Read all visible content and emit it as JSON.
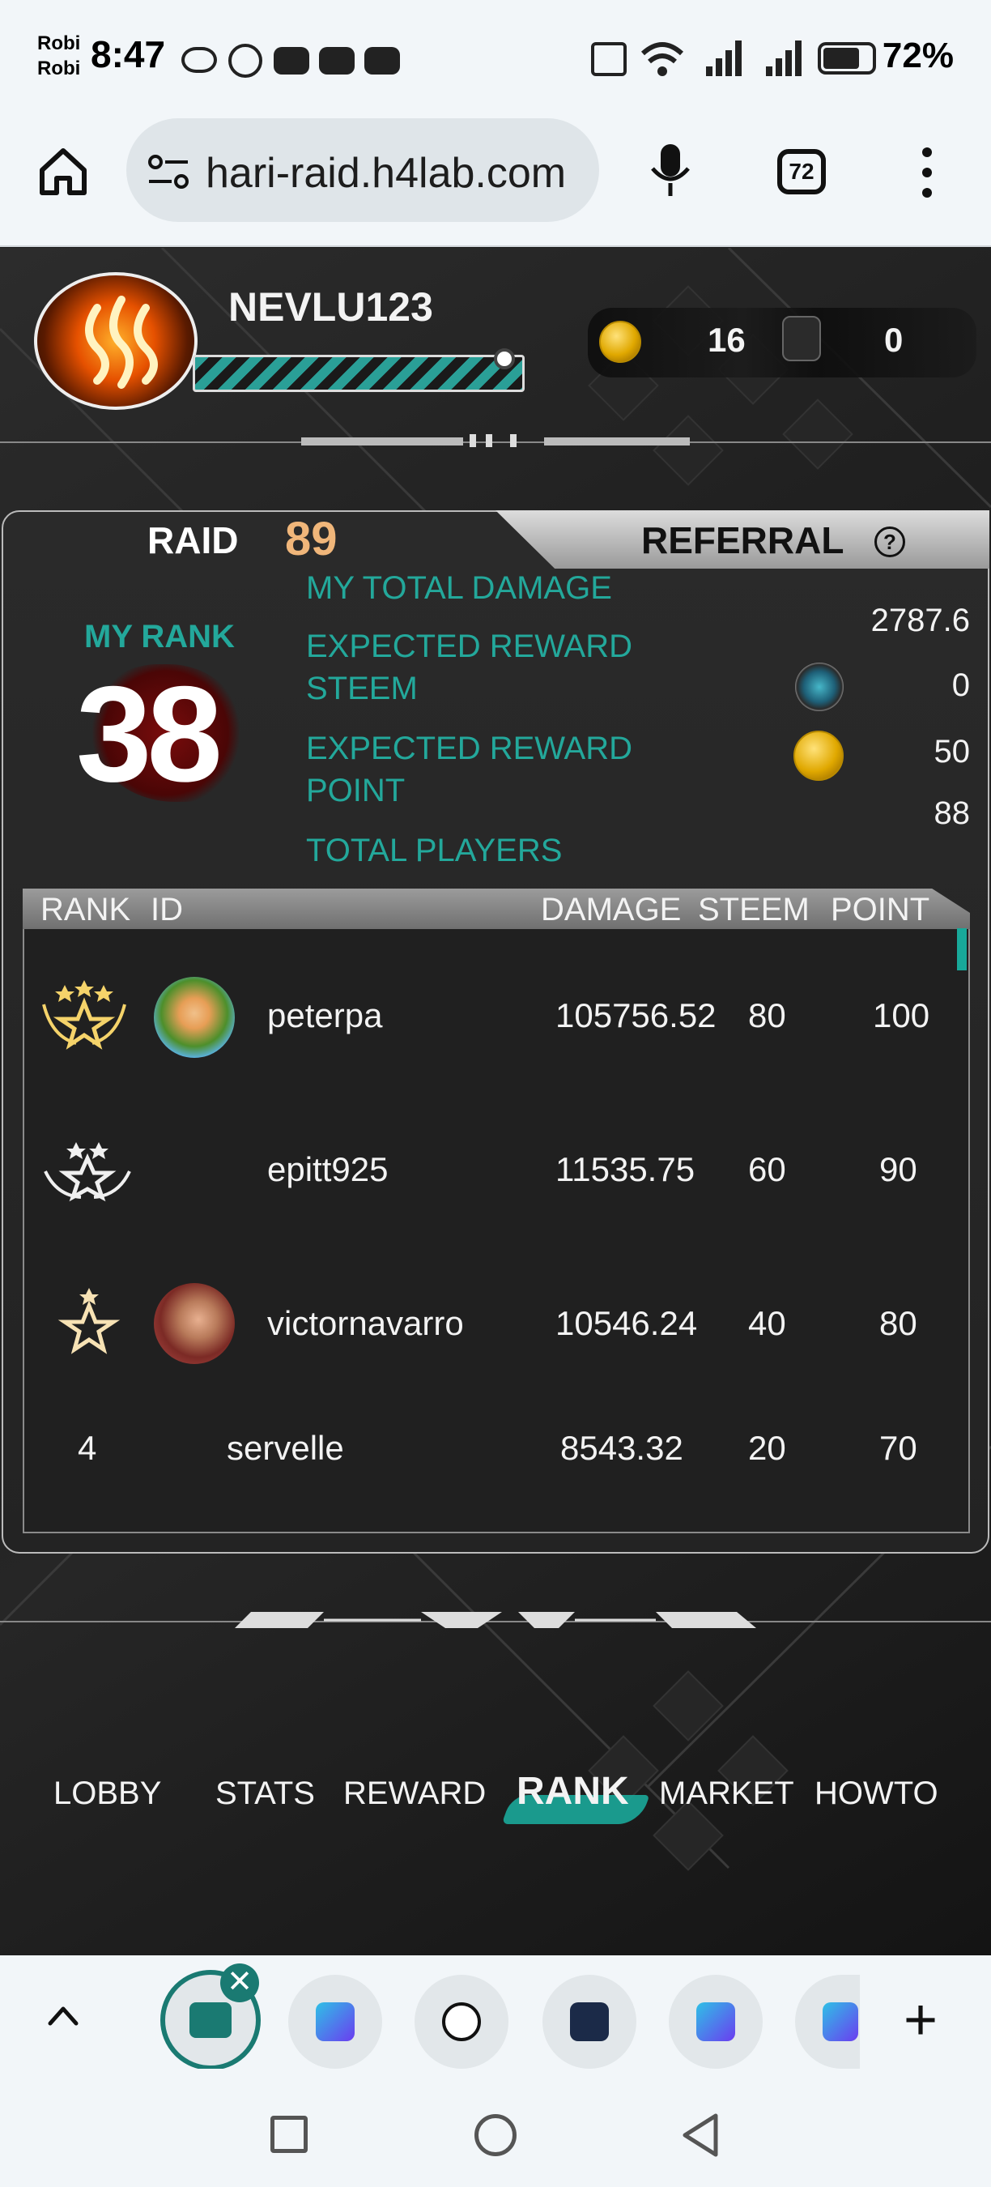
{
  "status_bar": {
    "carrier_line1": "Robi",
    "carrier_line2": "Robi",
    "time": "8:47",
    "battery": "72%"
  },
  "browser": {
    "url": "hari-raid.h4lab.com",
    "tab_count": "72"
  },
  "header": {
    "username": "NEVLU123",
    "points": "16",
    "tickets": "0"
  },
  "panel": {
    "raid_label": "RAID",
    "raid_number": "89",
    "referral_label": "REFERRAL",
    "help_glyph": "?",
    "my_rank_label": "MY RANK",
    "my_rank_value": "38",
    "stats": {
      "total_damage_label": "MY TOTAL DAMAGE",
      "total_damage_value": "2787.6",
      "reward_steem_label_1": "EXPECTED REWARD",
      "reward_steem_label_2": "STEEM",
      "reward_steem_value": "0",
      "reward_point_label_1": "EXPECTED REWARD",
      "reward_point_label_2": "POINT",
      "reward_point_value": "50",
      "total_players_label": "TOTAL PLAYERS",
      "total_players_value": "88"
    }
  },
  "table": {
    "headers": {
      "rank": "RANK",
      "id": "ID",
      "damage": "DAMAGE",
      "steem": "STEEM",
      "point": "POINT"
    },
    "rows": [
      {
        "rank": "1",
        "id": "peterpa",
        "damage": "105756.52",
        "steem": "80",
        "point": "100"
      },
      {
        "rank": "2",
        "id": "epitt925",
        "damage": "11535.75",
        "steem": "60",
        "point": "90"
      },
      {
        "rank": "3",
        "id": "victornavarro",
        "damage": "10546.24",
        "steem": "40",
        "point": "80"
      },
      {
        "rank": "4",
        "id": "servelle",
        "damage": "8543.32",
        "steem": "20",
        "point": "70"
      }
    ]
  },
  "nav": {
    "lobby": "LOBBY",
    "stats": "STATS",
    "reward": "REWARD",
    "rank": "RANK",
    "market": "MARKET",
    "howto": "HOWTO",
    "active": "rank"
  },
  "colors": {
    "accent_teal": "#23a89b",
    "raid_number": "#f0b67a"
  },
  "tabstrip": {
    "close_glyph": "✕",
    "add_glyph": "+"
  }
}
